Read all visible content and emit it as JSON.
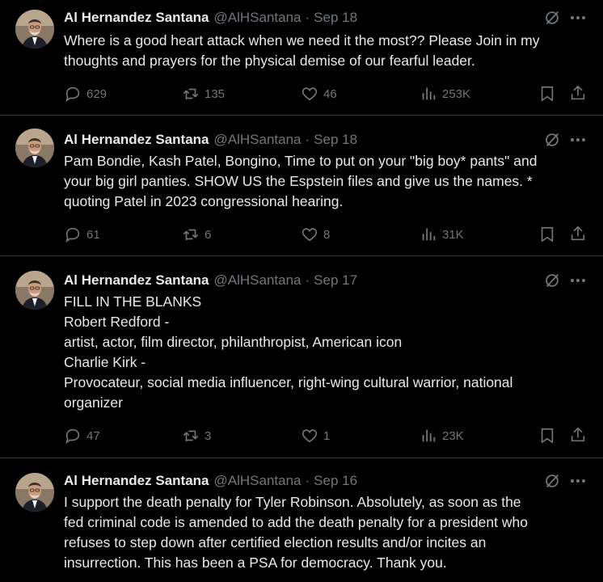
{
  "tweets": [
    {
      "name": "Al Hernandez Santana",
      "handle": "@AlHSantana",
      "date": "Sep 18",
      "lines": [
        "Where is a good heart attack when we need it the most?? Please Join in my",
        "thoughts and prayers for the physical demise of our fearful leader."
      ],
      "replies": "629",
      "reposts": "135",
      "likes": "46",
      "views": "253K"
    },
    {
      "name": "Al Hernandez Santana",
      "handle": "@AlHSantana",
      "date": "Sep 18",
      "lines": [
        "Pam Bondie, Kash Patel, Bongino, Time to put on your \"big boy* pants\" and",
        "your big girl panties. SHOW US the Espstein files and give us the names.  *",
        "quoting Patel in 2023 congressional hearing."
      ],
      "replies": "61",
      "reposts": "6",
      "likes": "8",
      "views": "31K"
    },
    {
      "name": "Al Hernandez Santana",
      "handle": "@AlHSantana",
      "date": "Sep 17",
      "lines": [
        "FILL IN THE BLANKS",
        "Robert Redford -",
        "artist, actor, film director, philanthropist, American icon",
        "Charlie Kirk -",
        "Provocateur, social media influencer, right-wing cultural warrior, national",
        "organizer"
      ],
      "replies": "47",
      "reposts": "3",
      "likes": "1",
      "views": "23K"
    },
    {
      "name": "Al Hernandez Santana",
      "handle": "@AlHSantana",
      "date": "Sep 16",
      "lines": [
        "I support the death penalty for Tyler Robinson. Absolutely, as soon as the",
        "fed criminal code is amended to add the death penalty for a president who",
        "refuses to step down after certified election results and/or incites an",
        "insurrection. This has been a PSA for democracy. Thank you."
      ]
    }
  ],
  "colors": {
    "background": "#000000",
    "text": "#e7e9ea",
    "muted": "#71767b",
    "divider": "#2f3336"
  },
  "icons": [
    "grok-icon",
    "more-icon",
    "reply-icon",
    "repost-icon",
    "like-icon",
    "views-icon",
    "bookmark-icon",
    "share-icon"
  ]
}
